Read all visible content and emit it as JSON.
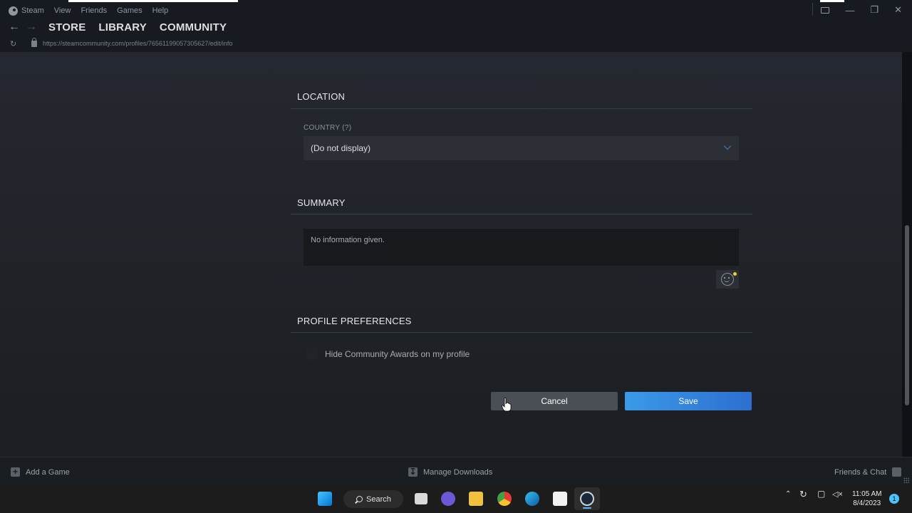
{
  "window": {
    "menu": [
      "Steam",
      "View",
      "Friends",
      "Games",
      "Help"
    ],
    "nav_tabs": [
      "STORE",
      "LIBRARY",
      "COMMUNITY"
    ],
    "url": "https://steamcommunity.com/profiles/76561199057305627/edit/info"
  },
  "sections": {
    "location": {
      "title": "LOCATION",
      "country_label": "COUNTRY (?)",
      "country_value": "(Do not display)"
    },
    "summary": {
      "title": "SUMMARY",
      "text": "No information given."
    },
    "preferences": {
      "title": "PROFILE PREFERENCES",
      "hide_awards_label": "Hide Community Awards on my profile",
      "hide_awards_checked": false
    }
  },
  "buttons": {
    "cancel": "Cancel",
    "save": "Save"
  },
  "footer": {
    "add_game": "Add a Game",
    "manage_downloads": "Manage Downloads",
    "friends_chat": "Friends & Chat"
  },
  "taskbar": {
    "search_label": "Search",
    "time": "11:05 AM",
    "date": "8/4/2023",
    "notification_count": "1"
  },
  "colors": {
    "accent_blue": "#3a9ae8",
    "background": "#171a21"
  }
}
